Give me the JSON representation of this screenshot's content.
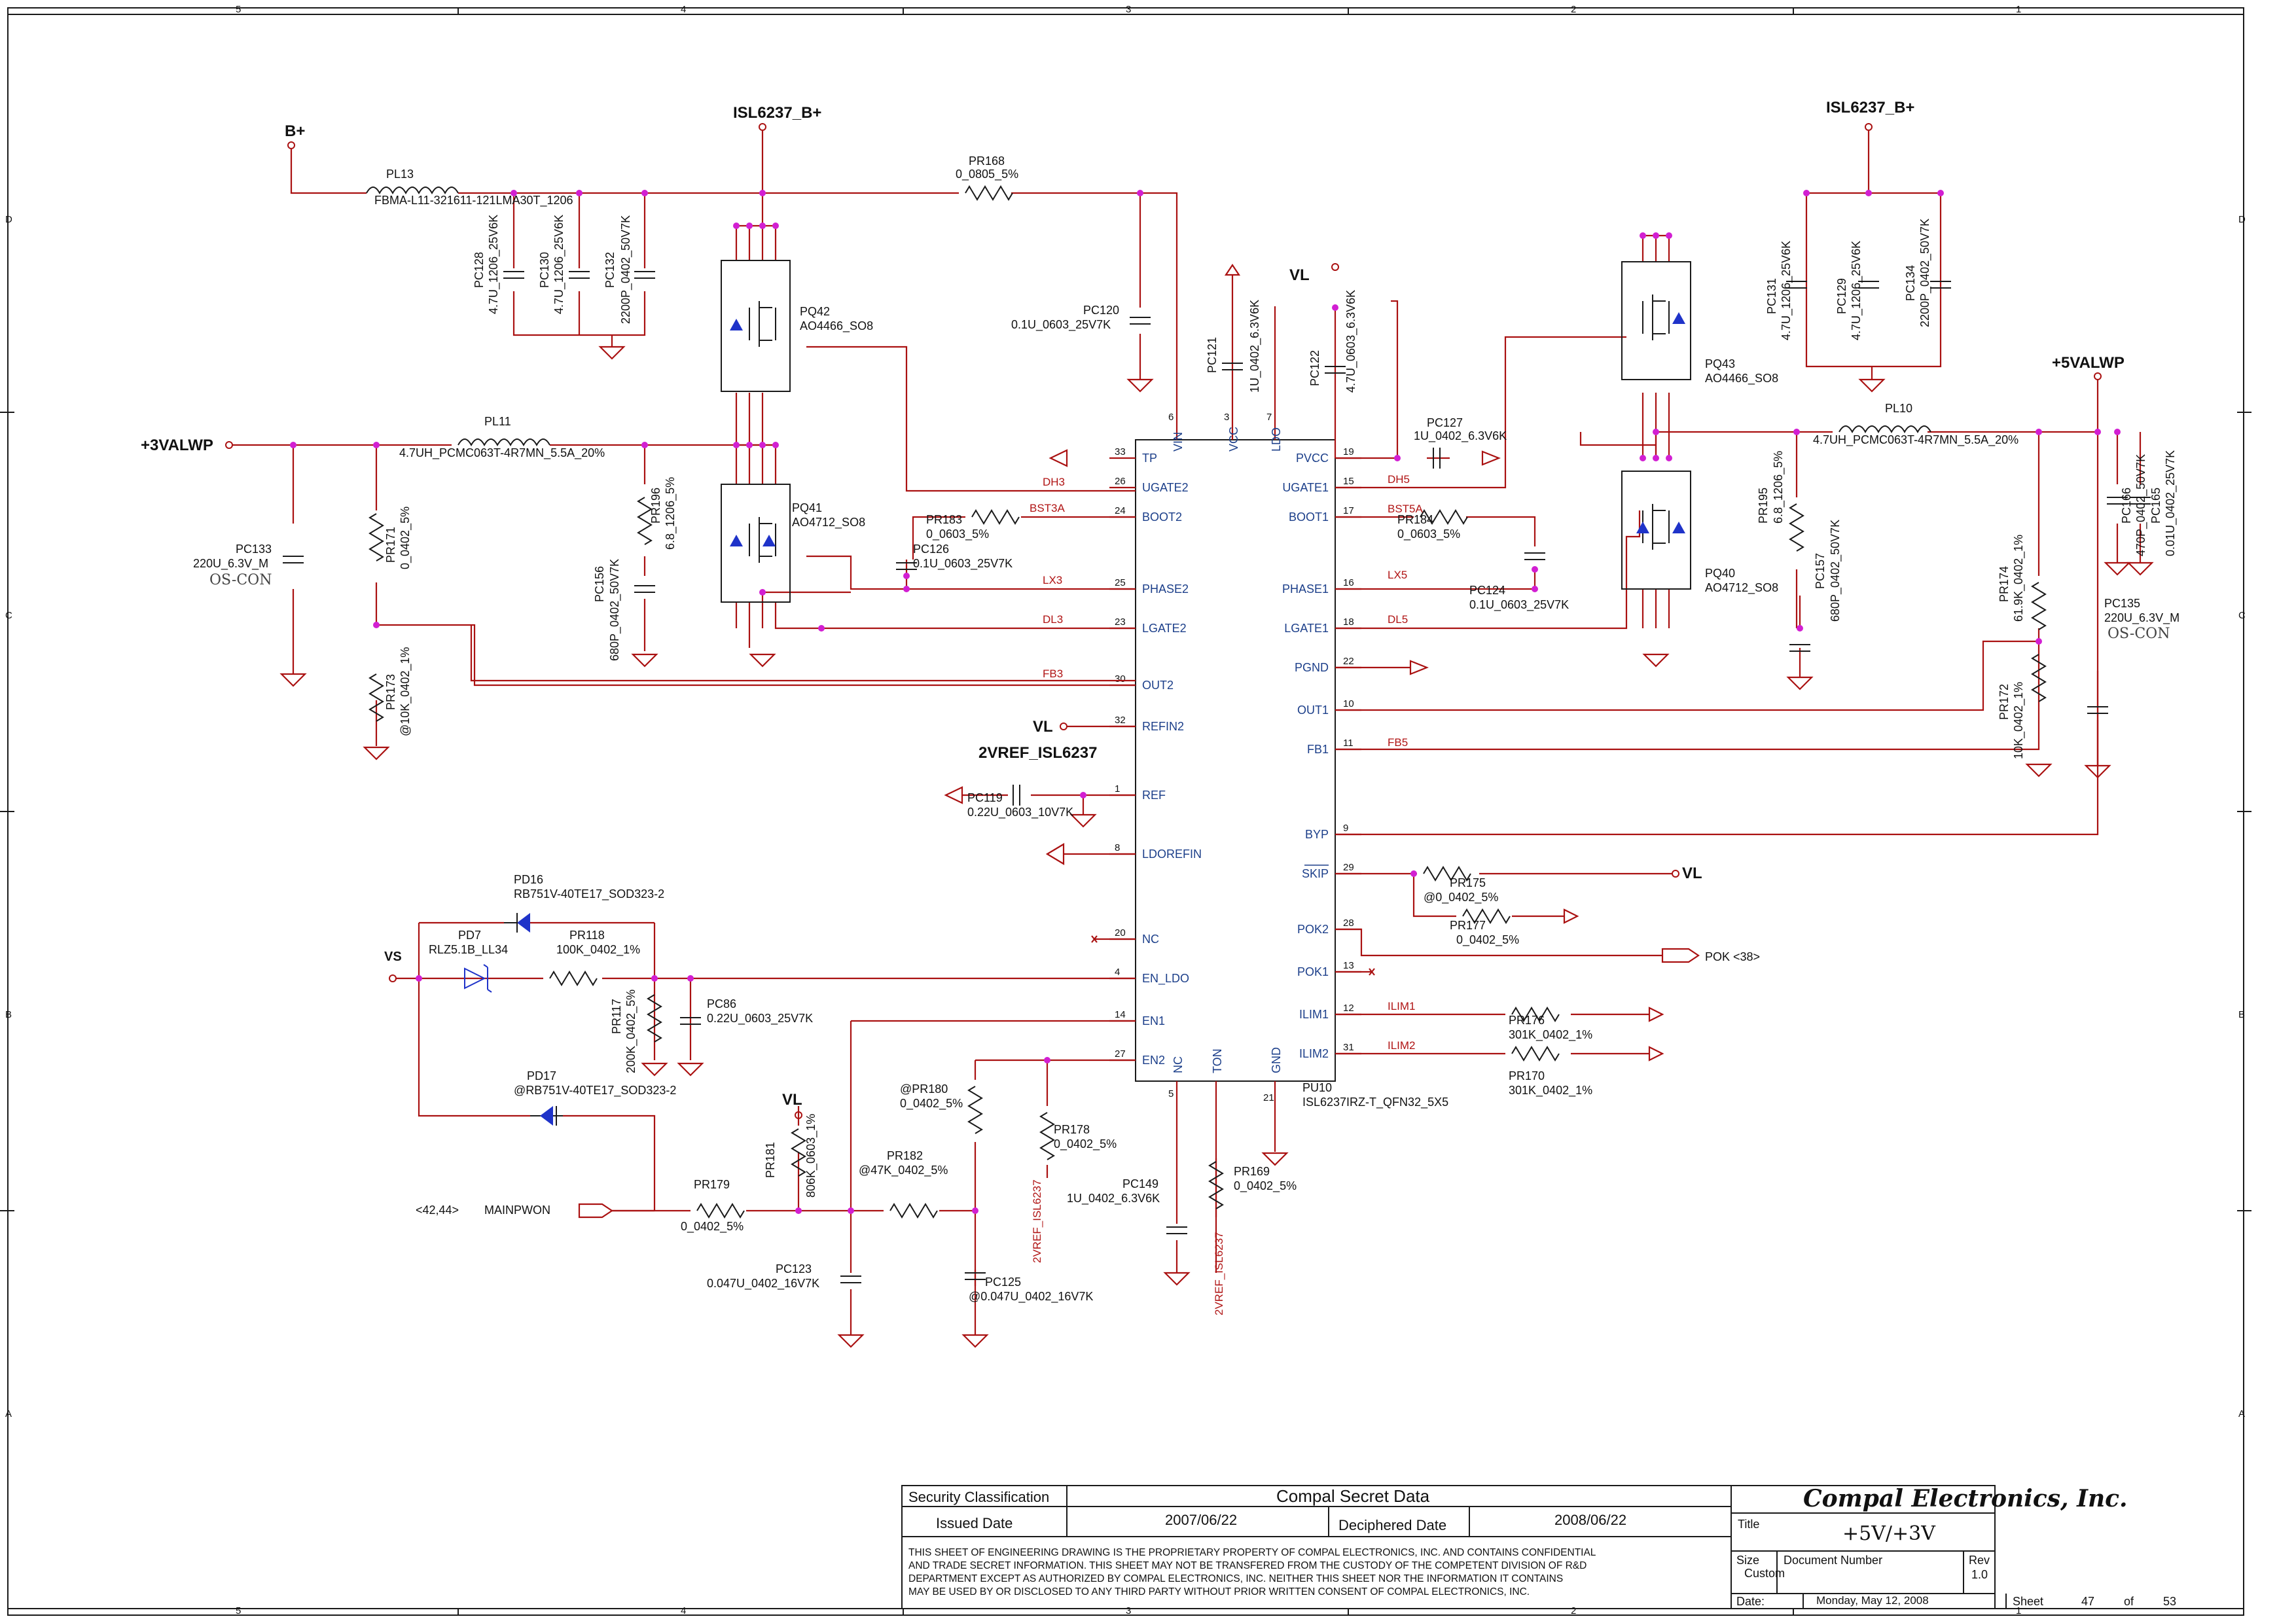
{
  "frame": {
    "zones_top": [
      "5",
      "4",
      "3",
      "2",
      "1"
    ],
    "zones_bottom": [
      "5",
      "4",
      "3",
      "2",
      "1"
    ],
    "zones_left": [
      "D",
      "C",
      "B",
      "A"
    ],
    "zones_right": [
      "D",
      "C",
      "B",
      "A"
    ]
  },
  "ic": {
    "ref": "PU10",
    "part": "ISL6237IRZ-T_QFN32_5X5",
    "left_pins": [
      {
        "num": "33",
        "name": "TP"
      },
      {
        "num": "26",
        "name": "UGATE2"
      },
      {
        "num": "24",
        "name": "BOOT2"
      },
      {
        "num": "25",
        "name": "PHASE2"
      },
      {
        "num": "23",
        "name": "LGATE2"
      },
      {
        "num": "30",
        "name": "OUT2"
      },
      {
        "num": "32",
        "name": "REFIN2"
      },
      {
        "num": "1",
        "name": "REF"
      },
      {
        "num": "8",
        "name": "LDOREFIN"
      },
      {
        "num": "20",
        "name": "NC"
      },
      {
        "num": "4",
        "name": "EN_LDO"
      },
      {
        "num": "14",
        "name": "EN1"
      },
      {
        "num": "27",
        "name": "EN2"
      }
    ],
    "right_pins": [
      {
        "num": "19",
        "name": "PVCC"
      },
      {
        "num": "15",
        "name": "UGATE1"
      },
      {
        "num": "17",
        "name": "BOOT1"
      },
      {
        "num": "16",
        "name": "PHASE1"
      },
      {
        "num": "18",
        "name": "LGATE1"
      },
      {
        "num": "22",
        "name": "PGND"
      },
      {
        "num": "10",
        "name": "OUT1"
      },
      {
        "num": "11",
        "name": "FB1"
      },
      {
        "num": "9",
        "name": "BYP"
      },
      {
        "num": "29",
        "name": "SKIP"
      },
      {
        "num": "28",
        "name": "POK2"
      },
      {
        "num": "13",
        "name": "POK1"
      },
      {
        "num": "12",
        "name": "ILIM1"
      },
      {
        "num": "31",
        "name": "ILIM2"
      }
    ],
    "top_pins": [
      {
        "num": "6",
        "name": "VIN"
      },
      {
        "num": "3",
        "name": "VCC"
      },
      {
        "num": "7",
        "name": "LDO"
      }
    ],
    "bottom_pins": [
      {
        "num": "5",
        "name": "NC"
      },
      {
        "num": "",
        "name": "TON"
      },
      {
        "num": "21",
        "name": "GND"
      }
    ]
  },
  "power_labels": {
    "b_plus": "B+",
    "isl_b_left": "ISL6237_B+",
    "isl_b_right": "ISL6237_B+",
    "valwp3": "+3VALWP",
    "valwp5": "+5VALWP",
    "vl_top": "VL",
    "vl_refin": "VL",
    "vl_skip": "VL",
    "vl_pr181": "VL",
    "vref": "2VREF_ISL6237",
    "vref_en2": "2VREF_ISL6237",
    "vref_ton": "2VREF_ISL6237",
    "vs": "VS",
    "mainpwon": "MAINPWON",
    "mainpwon_ref": "<42,44>",
    "pok": "POK",
    "pok_ref": "<38>"
  },
  "nets": {
    "dh3": "DH3",
    "bst3a": "BST3A",
    "lx3": "LX3",
    "dl3": "DL3",
    "fb3": "FB3",
    "dh5": "DH5",
    "bst5a": "BST5A",
    "lx5": "LX5",
    "dl5": "DL5",
    "fb5": "FB5",
    "ilim1": "ILIM1",
    "ilim2": "ILIM2"
  },
  "components": {
    "pl13": {
      "ref": "PL13",
      "value": "FBMA-L11-321611-121LMA30T_1206"
    },
    "pl11": {
      "ref": "PL11",
      "value": "4.7UH_PCMC063T-4R7MN_5.5A_20%"
    },
    "pl10": {
      "ref": "PL10",
      "value": "4.7UH_PCMC063T-4R7MN_5.5A_20%"
    },
    "pr168": {
      "ref": "PR168",
      "value": "0_0805_5%"
    },
    "pc128": {
      "ref": "PC128",
      "value": "4.7U_1206_25V6K"
    },
    "pc130": {
      "ref": "PC130",
      "value": "4.7U_1206_25V6K"
    },
    "pc132": {
      "ref": "PC132",
      "value": "2200P_0402_50V7K"
    },
    "pq42": {
      "ref": "PQ42",
      "value": "AO4466_SO8"
    },
    "pq41": {
      "ref": "PQ41",
      "value": "AO4712_SO8"
    },
    "pq43": {
      "ref": "PQ43",
      "value": "AO4466_SO8"
    },
    "pq40": {
      "ref": "PQ40",
      "value": "AO4712_SO8"
    },
    "pc120": {
      "ref": "PC120",
      "value": "0.1U_0603_25V7K"
    },
    "pc121": {
      "ref": "PC121",
      "value": "1U_0402_6.3V6K"
    },
    "pc122": {
      "ref": "PC122",
      "value": "4.7U_0603_6.3V6K"
    },
    "pc127": {
      "ref": "PC127",
      "value": "1U_0402_6.3V6K"
    },
    "pc131": {
      "ref": "PC131",
      "value": "4.7U_1206_25V6K"
    },
    "pc129": {
      "ref": "PC129",
      "value": "4.7U_1206_25V6K"
    },
    "pc134": {
      "ref": "PC134",
      "value": "2200P_0402_50V7K"
    },
    "pc133": {
      "ref": "PC133",
      "value": "220U_6.3V_M",
      "extra": "OS-CON"
    },
    "pc135": {
      "ref": "PC135",
      "value": "220U_6.3V_M",
      "extra": "OS-CON"
    },
    "pr171": {
      "ref": "PR171",
      "value": "0_0402_5%"
    },
    "pr173": {
      "ref": "PR173",
      "value": "@10K_0402_1%"
    },
    "pr196": {
      "ref": "PR196",
      "value": "6.8_1206_5%"
    },
    "pc156": {
      "ref": "PC156",
      "value": "680P_0402_50V7K"
    },
    "pr183": {
      "ref": "PR183",
      "value": "0_0603_5%"
    },
    "pc126": {
      "ref": "PC126",
      "value": "0.1U_0603_25V7K"
    },
    "pr184": {
      "ref": "PR184",
      "value": "0_0603_5%"
    },
    "pc124": {
      "ref": "PC124",
      "value": "0.1U_0603_25V7K"
    },
    "pr195": {
      "ref": "PR195",
      "value": "6.8_1206_5%"
    },
    "pc157": {
      "ref": "PC157",
      "value": "680P_0402_50V7K"
    },
    "pc166": {
      "ref": "PC166",
      "value": "470P_0402_50V7K"
    },
    "pc165": {
      "ref": "PC165",
      "value": "0.01U_0402_25V7K"
    },
    "pr174": {
      "ref": "PR174",
      "value": "61.9K_0402_1%"
    },
    "pr172": {
      "ref": "PR172",
      "value": "10K_0402_1%"
    },
    "pc119": {
      "ref": "PC119",
      "value": "0.22U_0603_10V7K"
    },
    "pr175": {
      "ref": "PR175",
      "value": "@0_0402_5%"
    },
    "pr177": {
      "ref": "PR177",
      "value": "0_0402_5%"
    },
    "pr176": {
      "ref": "PR176",
      "value": "301K_0402_1%"
    },
    "pr170": {
      "ref": "PR170",
      "value": "301K_0402_1%"
    },
    "pd16": {
      "ref": "PD16",
      "value": "RB751V-40TE17_SOD323-2"
    },
    "pd7": {
      "ref": "PD7",
      "value": "RLZ5.1B_LL34"
    },
    "pr118": {
      "ref": "PR118",
      "value": "100K_0402_1%"
    },
    "pr117": {
      "ref": "PR117",
      "value": "200K_0402_5%"
    },
    "pc86": {
      "ref": "PC86",
      "value": "0.22U_0603_25V7K"
    },
    "pd17": {
      "ref": "PD17",
      "value": "@RB751V-40TE17_SOD323-2"
    },
    "pr181": {
      "ref": "PR181",
      "value": "806K_0603_1%"
    },
    "pr179": {
      "ref": "PR179",
      "value": "0_0402_5%"
    },
    "pr182": {
      "ref": "PR182",
      "value": "@47K_0402_5%"
    },
    "pr180": {
      "ref": "PR180",
      "value": "@PR180"
    },
    "pr180v": {
      "ref": "",
      "value": "0_0402_5%"
    },
    "pr178": {
      "ref": "PR178",
      "value": "0_0402_5%"
    },
    "pc123": {
      "ref": "PC123",
      "value": "0.047U_0402_16V7K"
    },
    "pc125": {
      "ref": "PC125",
      "value": "@0.047U_0402_16V7K"
    },
    "pc149": {
      "ref": "PC149",
      "value": "1U_0402_6.3V6K"
    },
    "pr169": {
      "ref": "PR169",
      "value": "0_0402_5%"
    }
  },
  "title_block": {
    "security_label": "Security Classification",
    "security_value": "Compal Secret Data",
    "issued_label": "Issued Date",
    "issued_value": "2007/06/22",
    "deciphered_label": "Deciphered Date",
    "deciphered_value": "2008/06/22",
    "notice": [
      "THIS SHEET OF ENGINEERING DRAWING IS THE PROPRIETARY PROPERTY OF COMPAL ELECTRONICS, INC. AND CONTAINS CONFIDENTIAL",
      "AND TRADE SECRET INFORMATION. THIS SHEET MAY NOT BE TRANSFERED FROM THE CUSTODY OF THE COMPETENT DIVISION OF R&D",
      "DEPARTMENT EXCEPT AS AUTHORIZED BY COMPAL ELECTRONICS, INC. NEITHER THIS SHEET NOR THE INFORMATION IT CONTAINS",
      "MAY BE USED BY OR DISCLOSED TO ANY THIRD PARTY WITHOUT PRIOR WRITTEN CONSENT OF COMPAL ELECTRONICS, INC."
    ],
    "company": "Compal Electronics, Inc.",
    "title_label": "Title",
    "title_value": "+5V/+3V",
    "size_label": "Size",
    "size_value": "Custom",
    "docnum_label": "Document Number",
    "rev_label": "Rev",
    "rev_value": "1.0",
    "date_label": "Date:",
    "date_value": "Monday, May 12, 2008",
    "sheet_label": "Sheet",
    "sheet_value": "47",
    "of_label": "of",
    "of_value": "53"
  },
  "colors": {
    "wire": "#aa1111",
    "pin": "#1c3f8a",
    "junction": "#d21fd2",
    "diode": "#1f33c9",
    "net": "#b01414"
  }
}
